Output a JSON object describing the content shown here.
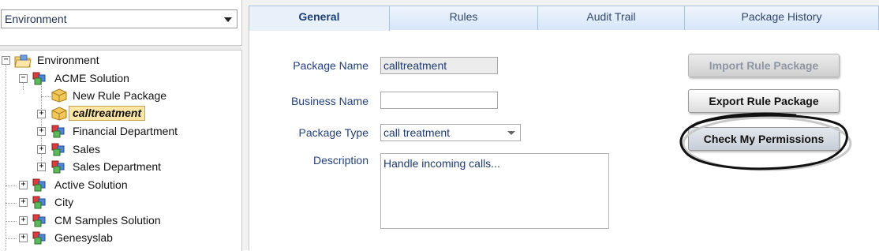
{
  "environment_select": {
    "value": "Environment"
  },
  "tree": {
    "root": {
      "label": "Environment"
    },
    "acme": {
      "label": "ACME Solution"
    },
    "acme_children": [
      {
        "label": "New Rule Package"
      },
      {
        "label": "calltreatment"
      },
      {
        "label": "Financial Department"
      },
      {
        "label": "Sales"
      },
      {
        "label": "Sales Department"
      }
    ],
    "solutions": [
      {
        "label": "Active Solution"
      },
      {
        "label": "City"
      },
      {
        "label": "CM Samples Solution"
      },
      {
        "label": "Genesyslab"
      }
    ]
  },
  "tabs": [
    {
      "label": "General"
    },
    {
      "label": "Rules"
    },
    {
      "label": "Audit Trail"
    },
    {
      "label": "Package History"
    }
  ],
  "form": {
    "package_name_label": "Package Name",
    "package_name_value": "calltreatment",
    "business_name_label": "Business Name",
    "business_name_value": "",
    "package_type_label": "Package Type",
    "package_type_value": "call treatment",
    "description_label": "Description",
    "description_value": "Handle incoming calls..."
  },
  "buttons": {
    "import": "Import Rule Package",
    "export": "Export Rule Package",
    "permissions": "Check My Permissions"
  },
  "colors": {
    "tab_active_text": "#1b3d77",
    "field_label": "#23407a",
    "selected_node_bg": "#fce6a6"
  },
  "icons": {
    "root": "folder-icon",
    "solution": "cubes-icon",
    "package": "package-box-icon"
  }
}
